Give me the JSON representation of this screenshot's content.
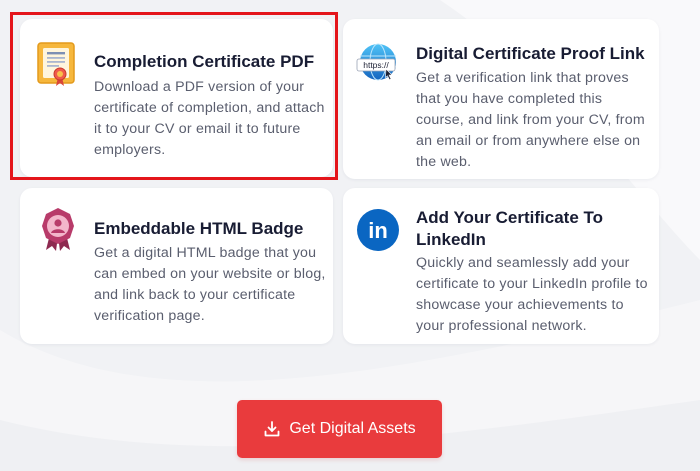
{
  "colors": {
    "accent": "#e93b3d",
    "selection_outline": "#e4151b",
    "title": "#181c33",
    "body_text": "#5a5e6e",
    "linkedin_blue": "#0a66c2"
  },
  "cards": [
    {
      "id": "pdf",
      "icon": "certificate-document-icon",
      "title": "Completion Certificate PDF",
      "description": "Download a PDF version of your certificate of completion, and attach it to your CV or email it to future employers.",
      "selected": true
    },
    {
      "id": "link",
      "icon": "globe-link-icon",
      "icon_label": "https://",
      "title": "Digital Certificate Proof Link",
      "description": "Get a verification link that proves that you have completed this course, and link from your CV, from an email or from anywhere else on the web."
    },
    {
      "id": "badge",
      "icon": "badge-icon",
      "title": "Embeddable HTML Badge",
      "description": "Get a digital HTML badge that you can embed on your website or blog, and link back to your certificate verification page."
    },
    {
      "id": "linkedin",
      "icon": "linkedin-icon",
      "icon_label": "in",
      "title": "Add Your Certificate To LinkedIn",
      "description": "Quickly and seamlessly add your certificate to your LinkedIn profile to showcase your achievements to your professional network."
    }
  ],
  "cta": {
    "icon": "download-icon",
    "label": "Get Digital Assets"
  }
}
